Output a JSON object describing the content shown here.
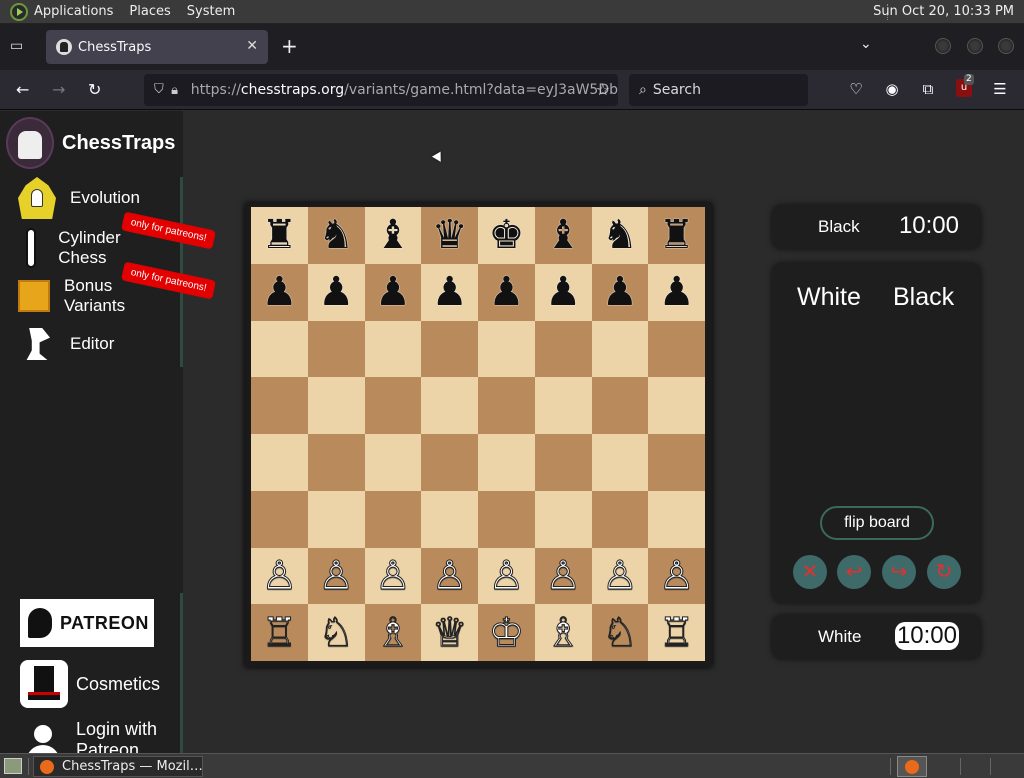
{
  "system_panel": {
    "menus": [
      "Applications",
      "Places",
      "System"
    ],
    "clock": "Sun Oct 20, 10:33 PM"
  },
  "browser": {
    "tab_title": "ChessTraps",
    "url_prefix": "https://",
    "url_host": "chesstraps.org",
    "url_path": "/variants/game.html?data=eyJ3aW5Db",
    "search_placeholder": "Search",
    "extension_badge": "2"
  },
  "sidebar": {
    "brand": "ChessTraps",
    "items": [
      {
        "label": "Evolution"
      },
      {
        "label": "Cylinder Chess"
      },
      {
        "label": "Bonus Variants"
      },
      {
        "label": "Editor"
      }
    ],
    "patreon_badge": "only for patreons!",
    "patreon_logo": "PATREON",
    "cosmetics": "Cosmetics",
    "login": "Login with Patreon"
  },
  "board": {
    "ranks": [
      [
        "♜",
        "♞",
        "♝",
        "♛",
        "♚",
        "♝",
        "♞",
        "♜"
      ],
      [
        "♟",
        "♟",
        "♟",
        "♟",
        "♟",
        "♟",
        "♟",
        "♟"
      ],
      [
        "",
        "",
        "",
        "",
        "",
        "",
        "",
        ""
      ],
      [
        "",
        "",
        "",
        "",
        "",
        "",
        "",
        ""
      ],
      [
        "",
        "",
        "",
        "",
        "",
        "",
        "",
        ""
      ],
      [
        "",
        "",
        "",
        "",
        "",
        "",
        "",
        ""
      ],
      [
        "♙",
        "♙",
        "♙",
        "♙",
        "♙",
        "♙",
        "♙",
        "♙"
      ],
      [
        "♖",
        "♘",
        "♗",
        "♕",
        "♔",
        "♗",
        "♘",
        "♖"
      ]
    ],
    "colors": {
      "light": "#ecd3a8",
      "dark": "#b98b5c"
    }
  },
  "game": {
    "black_label": "Black",
    "black_time": "10:00",
    "white_label": "White",
    "white_time": "10:00",
    "moves_header_white": "White",
    "moves_header_black": "Black",
    "flip_label": "flip board"
  },
  "taskbar": {
    "task_title": "ChessTraps — Mozil…"
  }
}
